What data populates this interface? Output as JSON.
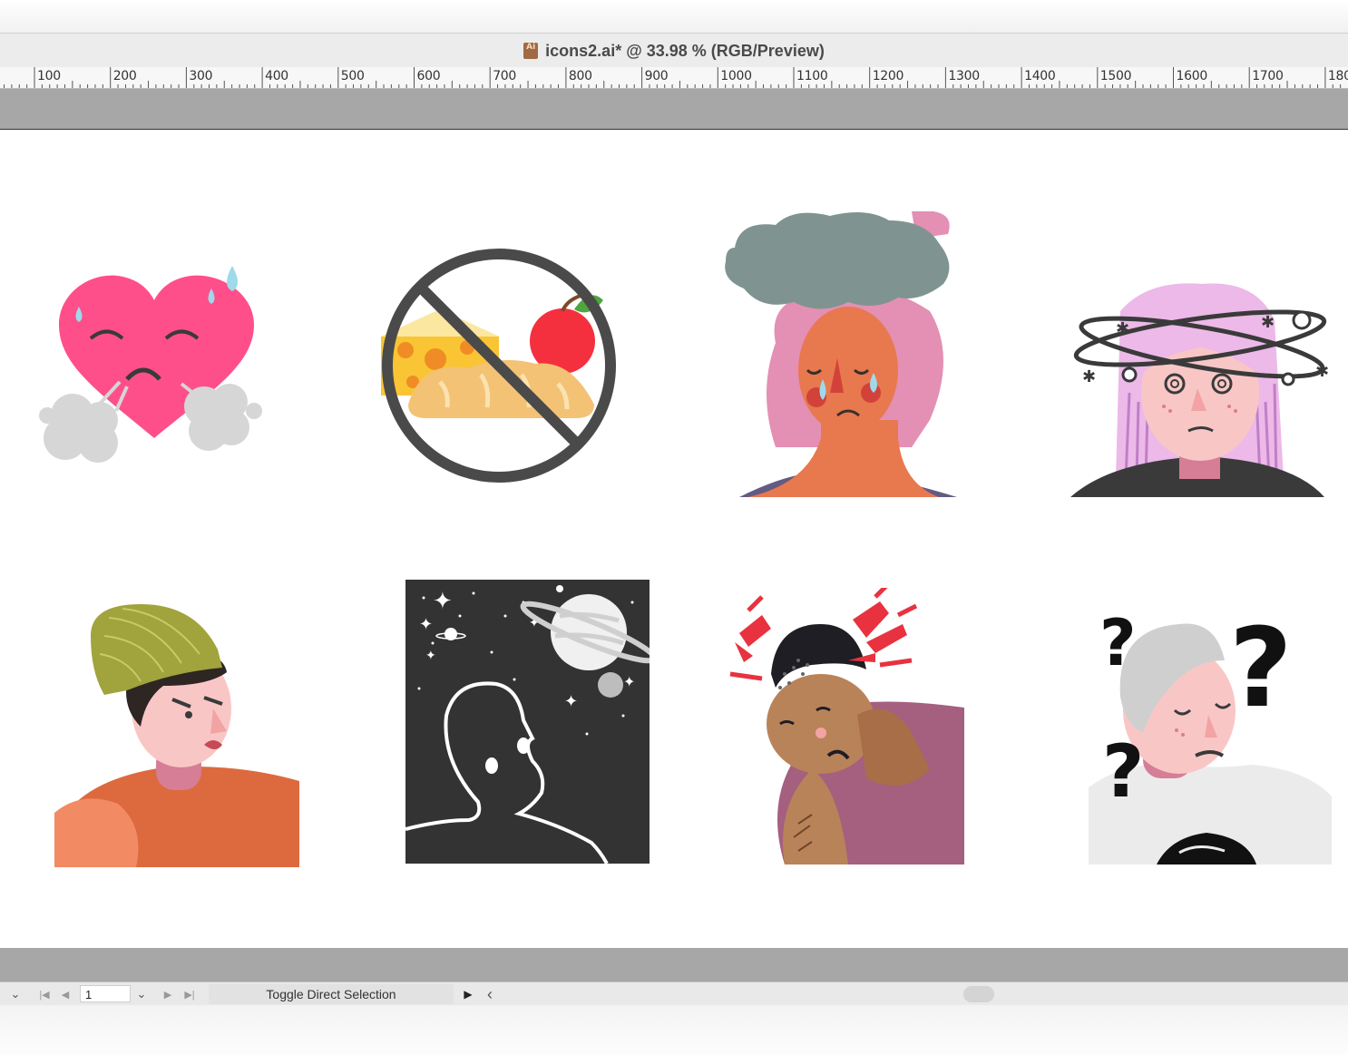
{
  "window": {
    "file_icon_label": "Ai",
    "title": "icons2.ai* @ 33.98 % (RGB/Preview)"
  },
  "ruler": {
    "labels": [
      "100",
      "200",
      "300",
      "400",
      "500",
      "600",
      "700",
      "800",
      "900",
      "1000",
      "1100",
      "1200",
      "1300",
      "1400",
      "1500",
      "1600",
      "1700",
      "180"
    ]
  },
  "artboard": {
    "icons": [
      {
        "name": "sweating-heart-icon"
      },
      {
        "name": "no-food-icon"
      },
      {
        "name": "sad-cloud-woman-icon"
      },
      {
        "name": "dizzy-woman-icon"
      },
      {
        "name": "angry-beanie-man-icon"
      },
      {
        "name": "space-silhouette-icon"
      },
      {
        "name": "headache-man-icon"
      },
      {
        "name": "confused-man-icon"
      }
    ]
  },
  "statusbar": {
    "page_number": "1",
    "status_text": "Toggle Direct Selection",
    "first_glyph": "|◀",
    "prev_glyph": "◀",
    "next_glyph": "▶",
    "last_glyph": "▶|",
    "dropdown_glyph": "⌄",
    "play_glyph": "▶",
    "scroll_left_glyph": "‹"
  },
  "colors": {
    "pasteboard": "#a7a7a7",
    "artboard": "#ffffff",
    "heart_pink": "#ff4f8b",
    "cloud_gray": "#7f9490"
  }
}
